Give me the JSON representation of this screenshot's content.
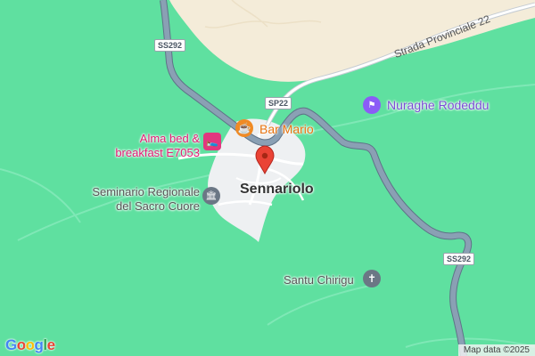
{
  "map": {
    "town_name": "Sennariolo",
    "attribution": "Map data ©2025",
    "google_logo": [
      "G",
      "o",
      "o",
      "g",
      "l",
      "e"
    ],
    "google_colors": [
      "#4285f4",
      "#ea4335",
      "#fbbc05",
      "#4285f4",
      "#34a853",
      "#ea4335"
    ],
    "colors": {
      "land": "#5fe0a0",
      "urban": "#eef0f2",
      "highway": "#8aa0b4",
      "sand": "#f4ecd9",
      "pin": "#ea4335"
    },
    "roads": {
      "ss292_top": "SS292",
      "sp22": "SP22",
      "ss292_right": "SS292",
      "provinciale": "Strada Provinciale 22"
    },
    "pois": [
      {
        "name": "Bar Mario",
        "icon": "coffee-icon"
      },
      {
        "name_line1": "Alma bed &",
        "name_line2": "breakfast E7053",
        "icon": "bed-icon"
      },
      {
        "name_line1": "Seminario Regionale",
        "name_line2": "del Sacro Cuore",
        "icon": "landmark-icon"
      },
      {
        "name": "Nuraghe Rodeddu",
        "icon": "monument-icon"
      },
      {
        "name": "Santu Chirigu",
        "icon": "church-icon"
      }
    ]
  }
}
